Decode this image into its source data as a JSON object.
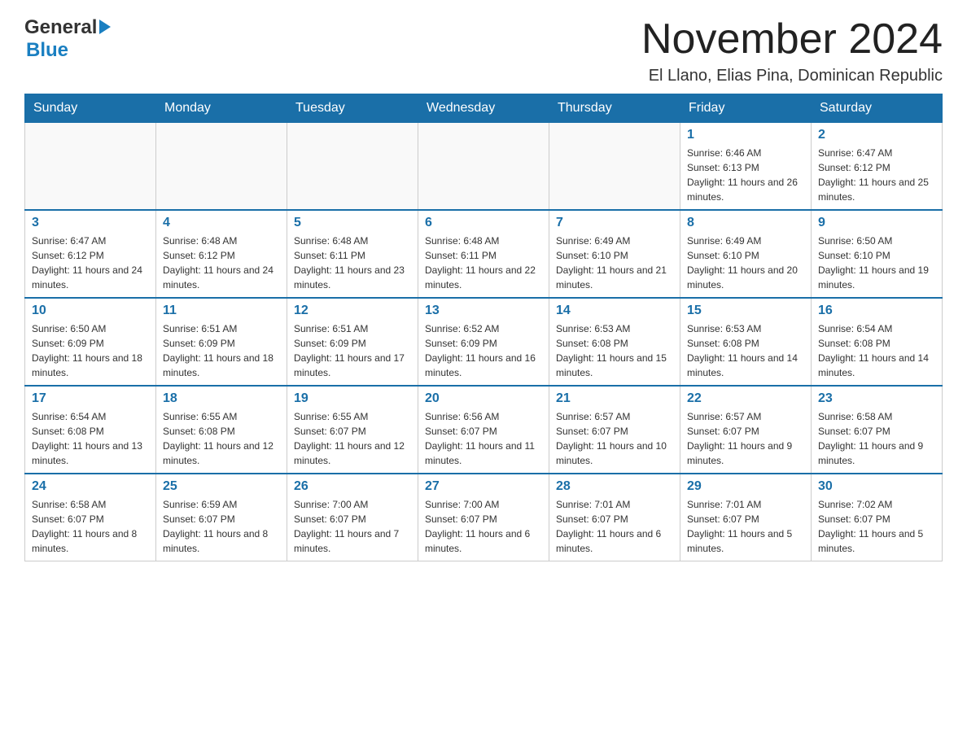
{
  "header": {
    "logo_general": "General",
    "logo_blue": "Blue",
    "title": "November 2024",
    "subtitle": "El Llano, Elias Pina, Dominican Republic"
  },
  "days_of_week": [
    "Sunday",
    "Monday",
    "Tuesday",
    "Wednesday",
    "Thursday",
    "Friday",
    "Saturday"
  ],
  "weeks": [
    [
      {
        "day": "",
        "info": ""
      },
      {
        "day": "",
        "info": ""
      },
      {
        "day": "",
        "info": ""
      },
      {
        "day": "",
        "info": ""
      },
      {
        "day": "",
        "info": ""
      },
      {
        "day": "1",
        "info": "Sunrise: 6:46 AM\nSunset: 6:13 PM\nDaylight: 11 hours and 26 minutes."
      },
      {
        "day": "2",
        "info": "Sunrise: 6:47 AM\nSunset: 6:12 PM\nDaylight: 11 hours and 25 minutes."
      }
    ],
    [
      {
        "day": "3",
        "info": "Sunrise: 6:47 AM\nSunset: 6:12 PM\nDaylight: 11 hours and 24 minutes."
      },
      {
        "day": "4",
        "info": "Sunrise: 6:48 AM\nSunset: 6:12 PM\nDaylight: 11 hours and 24 minutes."
      },
      {
        "day": "5",
        "info": "Sunrise: 6:48 AM\nSunset: 6:11 PM\nDaylight: 11 hours and 23 minutes."
      },
      {
        "day": "6",
        "info": "Sunrise: 6:48 AM\nSunset: 6:11 PM\nDaylight: 11 hours and 22 minutes."
      },
      {
        "day": "7",
        "info": "Sunrise: 6:49 AM\nSunset: 6:10 PM\nDaylight: 11 hours and 21 minutes."
      },
      {
        "day": "8",
        "info": "Sunrise: 6:49 AM\nSunset: 6:10 PM\nDaylight: 11 hours and 20 minutes."
      },
      {
        "day": "9",
        "info": "Sunrise: 6:50 AM\nSunset: 6:10 PM\nDaylight: 11 hours and 19 minutes."
      }
    ],
    [
      {
        "day": "10",
        "info": "Sunrise: 6:50 AM\nSunset: 6:09 PM\nDaylight: 11 hours and 18 minutes."
      },
      {
        "day": "11",
        "info": "Sunrise: 6:51 AM\nSunset: 6:09 PM\nDaylight: 11 hours and 18 minutes."
      },
      {
        "day": "12",
        "info": "Sunrise: 6:51 AM\nSunset: 6:09 PM\nDaylight: 11 hours and 17 minutes."
      },
      {
        "day": "13",
        "info": "Sunrise: 6:52 AM\nSunset: 6:09 PM\nDaylight: 11 hours and 16 minutes."
      },
      {
        "day": "14",
        "info": "Sunrise: 6:53 AM\nSunset: 6:08 PM\nDaylight: 11 hours and 15 minutes."
      },
      {
        "day": "15",
        "info": "Sunrise: 6:53 AM\nSunset: 6:08 PM\nDaylight: 11 hours and 14 minutes."
      },
      {
        "day": "16",
        "info": "Sunrise: 6:54 AM\nSunset: 6:08 PM\nDaylight: 11 hours and 14 minutes."
      }
    ],
    [
      {
        "day": "17",
        "info": "Sunrise: 6:54 AM\nSunset: 6:08 PM\nDaylight: 11 hours and 13 minutes."
      },
      {
        "day": "18",
        "info": "Sunrise: 6:55 AM\nSunset: 6:08 PM\nDaylight: 11 hours and 12 minutes."
      },
      {
        "day": "19",
        "info": "Sunrise: 6:55 AM\nSunset: 6:07 PM\nDaylight: 11 hours and 12 minutes."
      },
      {
        "day": "20",
        "info": "Sunrise: 6:56 AM\nSunset: 6:07 PM\nDaylight: 11 hours and 11 minutes."
      },
      {
        "day": "21",
        "info": "Sunrise: 6:57 AM\nSunset: 6:07 PM\nDaylight: 11 hours and 10 minutes."
      },
      {
        "day": "22",
        "info": "Sunrise: 6:57 AM\nSunset: 6:07 PM\nDaylight: 11 hours and 9 minutes."
      },
      {
        "day": "23",
        "info": "Sunrise: 6:58 AM\nSunset: 6:07 PM\nDaylight: 11 hours and 9 minutes."
      }
    ],
    [
      {
        "day": "24",
        "info": "Sunrise: 6:58 AM\nSunset: 6:07 PM\nDaylight: 11 hours and 8 minutes."
      },
      {
        "day": "25",
        "info": "Sunrise: 6:59 AM\nSunset: 6:07 PM\nDaylight: 11 hours and 8 minutes."
      },
      {
        "day": "26",
        "info": "Sunrise: 7:00 AM\nSunset: 6:07 PM\nDaylight: 11 hours and 7 minutes."
      },
      {
        "day": "27",
        "info": "Sunrise: 7:00 AM\nSunset: 6:07 PM\nDaylight: 11 hours and 6 minutes."
      },
      {
        "day": "28",
        "info": "Sunrise: 7:01 AM\nSunset: 6:07 PM\nDaylight: 11 hours and 6 minutes."
      },
      {
        "day": "29",
        "info": "Sunrise: 7:01 AM\nSunset: 6:07 PM\nDaylight: 11 hours and 5 minutes."
      },
      {
        "day": "30",
        "info": "Sunrise: 7:02 AM\nSunset: 6:07 PM\nDaylight: 11 hours and 5 minutes."
      }
    ]
  ]
}
